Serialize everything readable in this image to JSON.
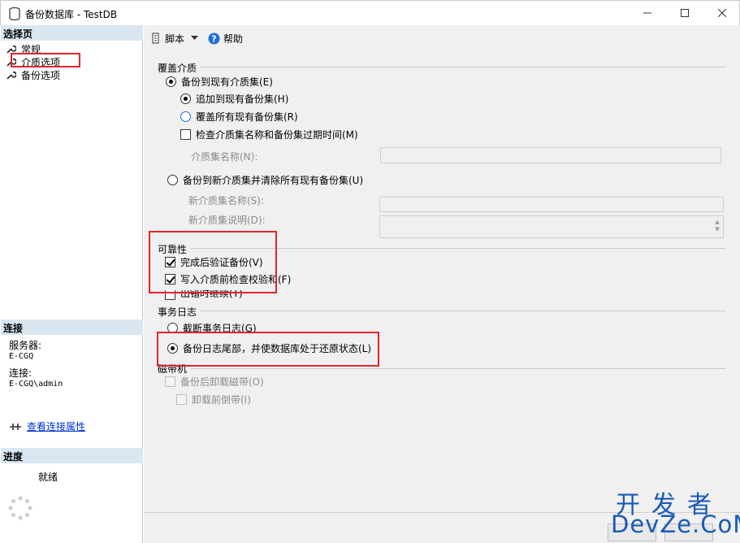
{
  "window": {
    "title": "备份数据库 - TestDB"
  },
  "left": {
    "select_page_header": "选择页",
    "nav_items": [
      {
        "label": "常规"
      },
      {
        "label": "介质选项"
      },
      {
        "label": "备份选项"
      }
    ],
    "connection_header": "连接",
    "server_label": "服务器:",
    "server_value": "E-CGQ",
    "connection_label": "连接:",
    "connection_value": "E-CGQ\\admin",
    "view_conn_props": "查看连接属性",
    "progress_header": "进度",
    "progress_status": "就绪"
  },
  "toolbar": {
    "script_label": "脚本",
    "help_label": "帮助"
  },
  "media": {
    "group_label": "覆盖介质",
    "backup_existing": "备份到现有介质集(E)",
    "append": "追加到现有备份集(H)",
    "overwrite": "覆盖所有现有备份集(R)",
    "check_expiry": "检查介质集名称和备份集过期时间(M)",
    "media_set_name_label": "介质集名称(N):",
    "backup_new": "备份到新介质集并清除所有现有备份集(U)",
    "new_media_name_label": "新介质集名称(S):",
    "new_media_desc_label": "新介质集说明(D):"
  },
  "reliability": {
    "group_label": "可靠性",
    "verify": "完成后验证备份(V)",
    "checksum": "写入介质前检查校验和(F)",
    "continue_on_error": "出错时继续(T)"
  },
  "transaction_log": {
    "group_label": "事务日志",
    "truncate": "截断事务日志(G)",
    "tail": "备份日志尾部，并使数据库处于还原状态(L)"
  },
  "tape": {
    "group_label": "磁带机",
    "unload": "备份后卸载磁带(O)",
    "rewind": "卸载前倒带(I)"
  },
  "watermark": {
    "cn": "开发者",
    "en": "DevZe.CoM"
  },
  "colors": {
    "highlight_red": "#e0242c",
    "section_header_bg": "#dbe6f3",
    "link_blue": "#0033cc",
    "watermark_blue": "#1a5ab8"
  }
}
